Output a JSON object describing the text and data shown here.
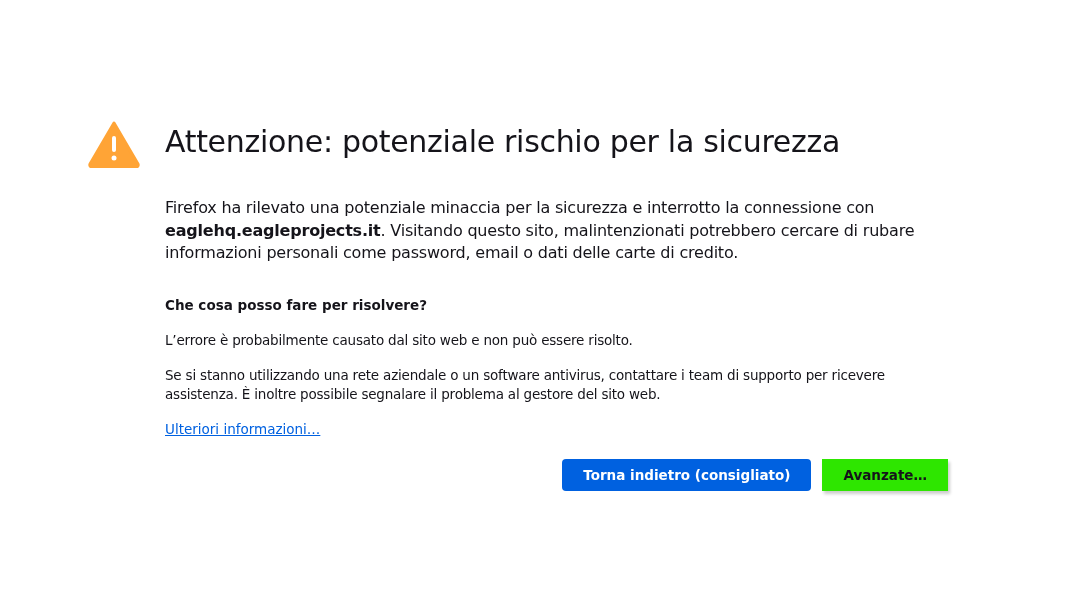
{
  "title": "Attenzione: potenziale rischio per la sicurezza",
  "intro": "Firefox ha rilevato una potenziale minaccia per la sicurezza e interrotto la connessione con **eaglehq.eagleprojects.it**. Visitando questo sito, malintenzionati potrebbero cercare di rubare informazioni personali come password, email o dati delle carte di credito.",
  "section_heading": "Che cosa posso fare per risolvere?",
  "paragraphs": [
    "L’errore è probabilmente causato dal sito web e non può essere risolto.",
    "Se si stanno utilizzando una rete aziendale o un software antivirus, contattare i team di supporto per ricevere assistenza. È inoltre possibile segnalare il problema al gestore del sito web."
  ],
  "link": "Ulteriori informazioni…",
  "buttons": [
    {
      "label": "Torna indietro (consigliato)",
      "kind": "primary"
    },
    {
      "label": "Avanzate…",
      "kind": "highlighted"
    }
  ]
}
